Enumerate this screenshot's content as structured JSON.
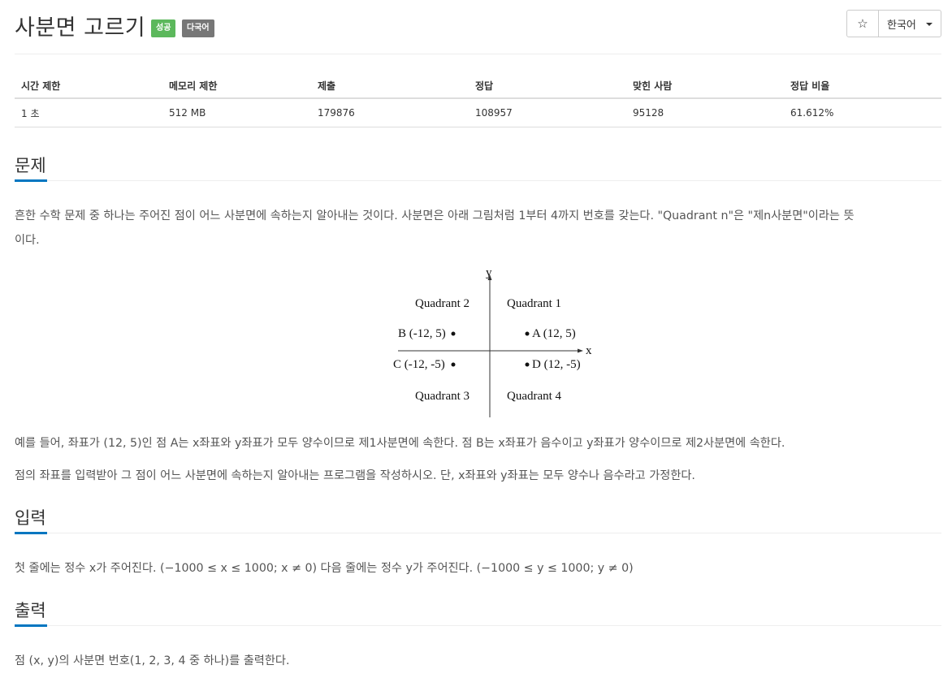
{
  "problem": {
    "title": "사분면 고르기",
    "badges": {
      "status": "성공",
      "language": "다국어"
    },
    "star_icon": "☆",
    "language_selector": "한국어"
  },
  "info_table": {
    "headers": [
      "시간 제한",
      "메모리 제한",
      "제출",
      "정답",
      "맞힌 사람",
      "정답 비율"
    ],
    "values": [
      "1 초",
      "512 MB",
      "179876",
      "108957",
      "95128",
      "61.612%"
    ]
  },
  "sections": {
    "problem": {
      "heading": "문제",
      "p1_line1": "흔한 수학 문제 중 하나는 주어진 점이 어느 사분면에 속하는지 알아내는 것이다. 사분면은 아래 그림처럼 1부터 4까지 번호를 갖는다. \"Quadrant n\"은 \"제n사분면\"이라는 뜻",
      "p1_line2": "이다.",
      "p2": "예를 들어, 좌표가 (12, 5)인 점 A는 x좌표와 y좌표가 모두 양수이므로 제1사분면에 속한다. 점 B는 x좌표가 음수이고 y좌표가 양수이므로 제2사분면에 속한다.",
      "p3": "점의 좌표를 입력받아 그 점이 어느 사분면에 속하는지 알아내는 프로그램을 작성하시오. 단, x좌표와 y좌표는 모두 양수나 음수라고 가정한다."
    },
    "input": {
      "heading": "입력",
      "text": "첫 줄에는 정수 x가 주어진다. (−1000 ≤ x ≤ 1000; x ≠ 0) 다음 줄에는 정수 y가 주어진다. (−1000 ≤ y ≤ 1000; y ≠ 0)"
    },
    "output": {
      "heading": "출력",
      "text": "점 (x, y)의 사분면 번호(1, 2, 3, 4 중 하나)를 출력한다."
    }
  },
  "figure": {
    "y_label": "y",
    "x_label": "x",
    "q1": "Quadrant 1",
    "q2": "Quadrant 2",
    "q3": "Quadrant 3",
    "q4": "Quadrant 4",
    "point_a": "A (12, 5)",
    "point_b": "B (-12, 5)",
    "point_c": "C (-12, -5)",
    "point_d": "D (12, -5)"
  }
}
